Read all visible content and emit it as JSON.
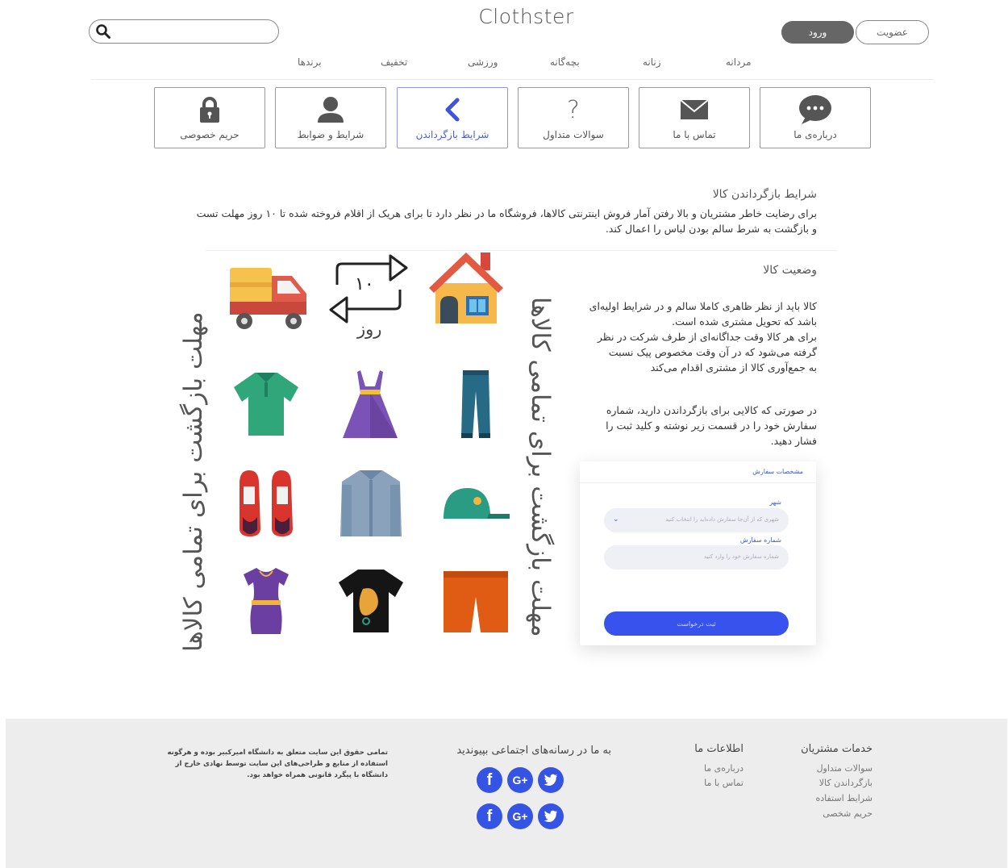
{
  "header": {
    "logo": "Clothster",
    "login_label": "ورود",
    "signup_label": "عضویت",
    "search_placeholder": ""
  },
  "nav": [
    "مردانه",
    "زنانه",
    "بچه‌گانه",
    "ورزشی",
    "تخفیف",
    "برندها"
  ],
  "tiles": [
    {
      "label": "درباره‌ی ما",
      "icon": "chat-bubble-icon"
    },
    {
      "label": "تماس با ما",
      "icon": "envelope-icon"
    },
    {
      "label": "سوالات متداول",
      "icon": "question-icon"
    },
    {
      "label": "شرایط بازگرداندن",
      "icon": "chevron-left-icon",
      "active": true
    },
    {
      "label": "شرایط و ضوابط",
      "icon": "user-icon"
    },
    {
      "label": "حریم خصوصی",
      "icon": "lock-icon"
    }
  ],
  "returns": {
    "title": "شرایط بازگرداندن کالا",
    "line1": "برای رضایت خاطر مشتریان و بالا رفتن آمار فروش اینترنتی کالاها، فروشگاه ما در نظر دارد تا برای هریک از اقلام فروخته شده تا ۱۰ روز مهلت تست",
    "line2": "و بازگشت به شرط سالم بودن لباس را اعمال کند."
  },
  "status": {
    "title": "وضعیت کالا",
    "p1": [
      "کالا باید از نظر ظاهری کاملا سالم و در شرایط اولیه‌ای",
      "باشد که تحویل مشتری شده است.",
      "برای هر کالا وقت جداگانه‌ای از طرف شرکت در نظر",
      "گرفته می‌شود که در آن وقت مخصوص پیک نسبت",
      "به جمع‌آوری کالا از مشتری اقدام می‌کند"
    ],
    "p2": [
      "در صورتی که کالایی برای بازگرداندن دارید، شماره",
      "سفارش خود را در قسمت زیر نوشته و کلید ثبت را",
      "فشار دهید."
    ]
  },
  "illustration": {
    "days_number": "۱۰",
    "days_label": "روز",
    "vertical_left": "مهلت بازگشت برای تمامی کالاها",
    "vertical_right": "مهلت بازگشت برای تمامی کالاها",
    "colors": {
      "truck": "#e0574b",
      "arrows": "#222222",
      "house": "#f0a63c"
    }
  },
  "form": {
    "header": "مشخصات سفارش",
    "city_label": "شهر",
    "city_placeholder": "شهری که از آن‌جا سفارش داده‌اید را انتخاب کنید",
    "order_label": "شماره سفارش",
    "order_placeholder": "شماره سفارش خود را وارد کنید",
    "submit_label": "ثبت درخواست",
    "accent": "#3852ee"
  },
  "footer": {
    "services_title": "خدمات مشتریان",
    "services_links": [
      "سوالات متداول",
      "بازگرداندن کالا",
      "شرایط استفاده",
      "حریم شخصی"
    ],
    "about_title": "اطلاعات ما",
    "about_links": [
      "درباره‌ی ما",
      "تماس با ما"
    ],
    "social_title": "به ما در رسانه‌های اجتماعی بپیوندید",
    "social_icons": [
      "twitter-icon",
      "google-plus-icon",
      "facebook-icon"
    ],
    "copyright": [
      "تمامی حقوق این سایت متعلق به دانشگاه امیرکبیر بوده و هرگونه",
      "استفاده از منابع و طراحی‌های این سایت توسط نهادی خارج از",
      "دانشگاه با پیگرد قانونی همراه خواهد بود."
    ]
  }
}
